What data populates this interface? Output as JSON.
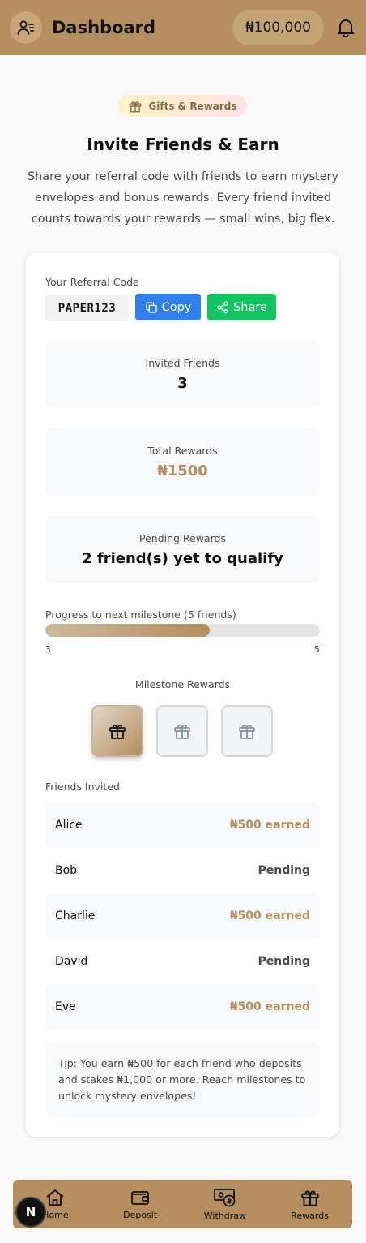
{
  "header": {
    "title": "Dashboard",
    "balance": "₦100,000",
    "avatar_icon": "user-menu-icon",
    "bell_icon": "bell-icon"
  },
  "intro": {
    "pill": "Gifts & Rewards",
    "title": "Invite Friends & Earn",
    "subtitle": "Share your referral code with friends to earn mystery envelopes and bonus rewards. Every friend invited counts towards your rewards — small wins, big flex."
  },
  "referral": {
    "label": "Your Referral Code",
    "code": "PAPER123",
    "copy_label": "Copy",
    "share_label": "Share"
  },
  "stats": {
    "invited_label": "Invited Friends",
    "invited_value": "3",
    "total_label": "Total Rewards",
    "total_value": "₦1500",
    "pending_label": "Pending Rewards",
    "pending_value": "2 friend(s) yet to qualify"
  },
  "progress": {
    "label": "Progress to next milestone (5 friends)",
    "current": "3",
    "target": "5",
    "fraction": 0.6
  },
  "milestones": {
    "label": "Milestone Rewards",
    "items": [
      {
        "icon": "gift-icon",
        "unlocked": true
      },
      {
        "icon": "gift-icon",
        "unlocked": false
      },
      {
        "icon": "gift-icon",
        "unlocked": false
      }
    ]
  },
  "friends": {
    "label": "Friends Invited",
    "list": [
      {
        "name": "Alice",
        "status": "₦500 earned",
        "earned": true
      },
      {
        "name": "Bob",
        "status": "Pending",
        "earned": false
      },
      {
        "name": "Charlie",
        "status": "₦500 earned",
        "earned": true
      },
      {
        "name": "David",
        "status": "Pending",
        "earned": false
      },
      {
        "name": "Eve",
        "status": "₦500 earned",
        "earned": true
      }
    ]
  },
  "tip": "Tip: You earn ₦500 for each friend who deposits and stakes ₦1,000 or more. Reach milestones to unlock mystery envelopes!",
  "nav": {
    "items": [
      {
        "label": "Home",
        "icon": "home-icon"
      },
      {
        "label": "Deposit",
        "icon": "wallet-icon"
      },
      {
        "label": "Withdraw",
        "icon": "cash-icon"
      },
      {
        "label": "Rewards",
        "icon": "gift-icon"
      }
    ],
    "badge": "N"
  },
  "colors": {
    "brand": "#b48e5e",
    "copy": "#2f80ed",
    "share": "#12c462"
  }
}
